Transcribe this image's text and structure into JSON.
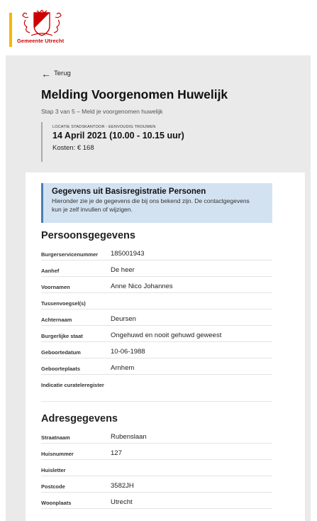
{
  "header": {
    "logo_text": "Gemeente Utrecht",
    "accent_color": "#f5b800",
    "brand_color": "#cc0000"
  },
  "nav": {
    "back_label": "Terug",
    "back_icon": "arrow-left-icon"
  },
  "page": {
    "title": "Melding Voorgenomen Huwelijk",
    "step": "Stap 3 van 5 – Meld je voorgenomen huwelijk"
  },
  "location": {
    "label": "LOCATIE STADSKANTOOR - EENVOUDIG TROUWEN",
    "date": "14 April 2021 (10.00 - 10.15 uur)",
    "cost": "Kosten: € 168"
  },
  "info": {
    "title": "Gegevens uit Basisregistratie Personen",
    "text": "Hieronder zie je de gegevens die bij ons bekend zijn. De contactgegevens kun je zelf invullen of wijzigen.",
    "color": "#d3e2f1"
  },
  "persoons": {
    "title": "Persoonsgegevens",
    "rows": [
      {
        "label": "Burgerservicenummer",
        "value": "185001943"
      },
      {
        "label": "Aanhef",
        "value": "De heer"
      },
      {
        "label": "Voornamen",
        "value": "Anne Nico Johannes"
      },
      {
        "label": "Tussenvoegsel(s)",
        "value": ""
      },
      {
        "label": "Achternaam",
        "value": "Deursen"
      },
      {
        "label": "Burgerlijke staat",
        "value": "Ongehuwd en nooit gehuwd geweest"
      },
      {
        "label": "Geboortedatum",
        "value": "10-06-1988"
      },
      {
        "label": "Geboorteplaats",
        "value": "Arnhem"
      },
      {
        "label": "Indicatie curateleregister",
        "value": ""
      }
    ]
  },
  "adres": {
    "title": "Adresgegevens",
    "rows": [
      {
        "label": "Straatnaam",
        "value": "Rubenslaan"
      },
      {
        "label": "Huisnummer",
        "value": "127"
      },
      {
        "label": "Huisletter",
        "value": ""
      },
      {
        "label": "Postcode",
        "value": "3582JH"
      },
      {
        "label": "Woonplaats",
        "value": "Utrecht"
      }
    ]
  }
}
